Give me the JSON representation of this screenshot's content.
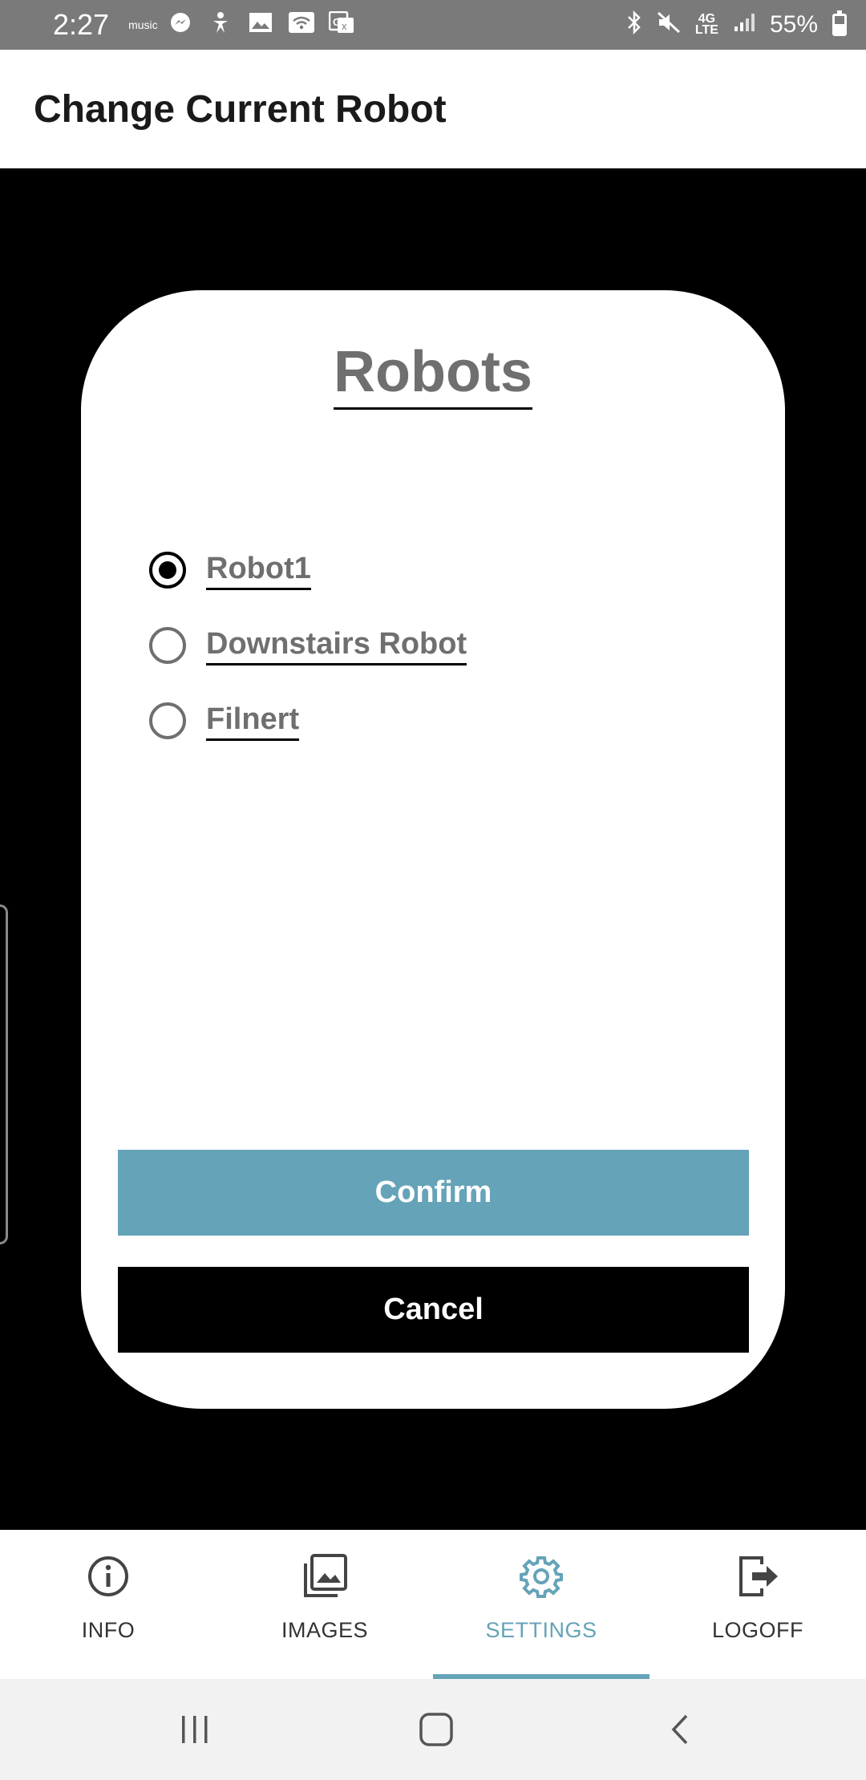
{
  "status_bar": {
    "time": "2:27",
    "battery": "55%",
    "left_icons": [
      "amazon-music-icon",
      "messenger-icon",
      "accessibility-icon",
      "image-icon",
      "wifi-icon",
      "translate-icon"
    ],
    "right_icons": [
      "bluetooth-icon",
      "mute-icon",
      "4g-lte-icon",
      "signal-icon",
      "battery-icon"
    ]
  },
  "header": {
    "title": "Change Current Robot"
  },
  "dialog": {
    "title": "Robots",
    "options": [
      {
        "label": "Robot1",
        "checked": true
      },
      {
        "label": "Downstairs Robot",
        "checked": false
      },
      {
        "label": "Filnert",
        "checked": false
      }
    ],
    "confirm_label": "Confirm",
    "cancel_label": "Cancel"
  },
  "bottom_nav": {
    "items": [
      {
        "label": "INFO",
        "icon": "info-icon",
        "active": false
      },
      {
        "label": "IMAGES",
        "icon": "images-icon",
        "active": false
      },
      {
        "label": "SETTINGS",
        "icon": "gear-icon",
        "active": true
      },
      {
        "label": "LOGOFF",
        "icon": "logout-icon",
        "active": false
      }
    ]
  },
  "colors": {
    "accent": "#65a3b8",
    "status_bar": "#7a7a7a",
    "text_muted": "#6f6f6f"
  }
}
